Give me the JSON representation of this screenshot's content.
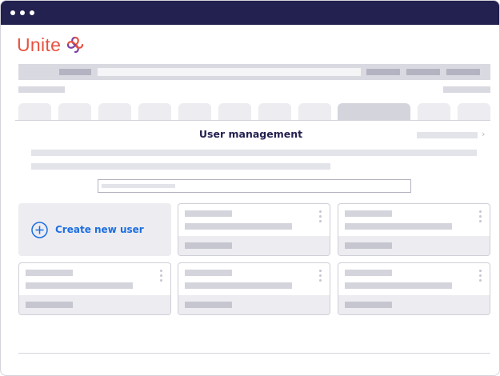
{
  "app": {
    "logo_text": "Unite"
  },
  "main": {
    "heading": "User management",
    "create_button_label": "Create new user"
  },
  "colors": {
    "titlebar": "#23214f",
    "brand": "#e8523f",
    "accent": "#1d6ee0"
  },
  "icons": {
    "logo": "unite-knot-icon",
    "create": "plus-circle-icon",
    "breadcrumb": "chevron-right-icon",
    "card_menu": "kebab-menu-icon"
  }
}
